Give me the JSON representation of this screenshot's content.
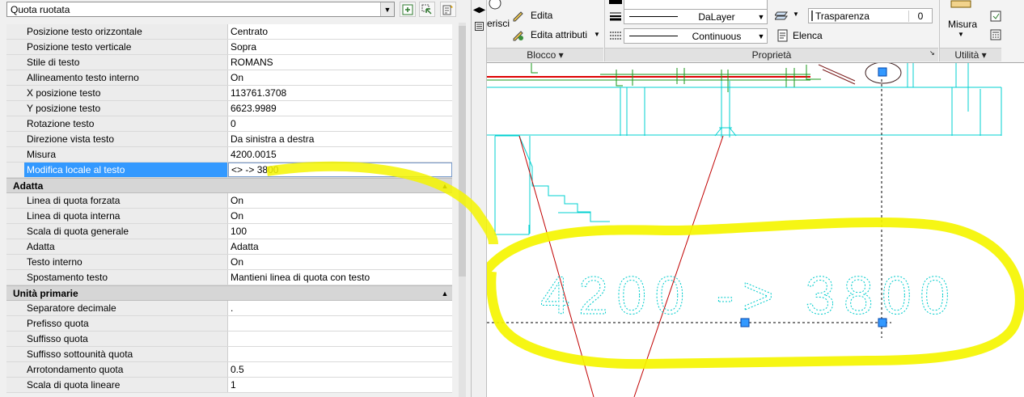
{
  "palette": {
    "selector_value": "Quota ruotata",
    "rows_top": [
      {
        "key": "Posizione testo orizzontale",
        "value": "Centrato"
      },
      {
        "key": "Posizione testo verticale",
        "value": "Sopra"
      },
      {
        "key": "Stile di testo",
        "value": "ROMANS"
      },
      {
        "key": "Allineamento testo interno",
        "value": "On"
      },
      {
        "key": "X posizione testo",
        "value": "113761.3708"
      },
      {
        "key": "Y posizione testo",
        "value": "6623.9989"
      },
      {
        "key": "Rotazione testo",
        "value": "0"
      },
      {
        "key": "Direzione vista testo",
        "value": "Da sinistra a destra"
      },
      {
        "key": "Misura",
        "value": "4200.0015"
      },
      {
        "key": "Modifica locale al testo",
        "value": "<> -> 3800"
      }
    ],
    "cat_adatta": "Adatta",
    "rows_adatta": [
      {
        "key": "Linea di quota forzata",
        "value": "On"
      },
      {
        "key": "Linea di quota interna",
        "value": "On"
      },
      {
        "key": "Scala di quota generale",
        "value": "100"
      },
      {
        "key": "Adatta",
        "value": "Adatta"
      },
      {
        "key": "Testo interno",
        "value": "On"
      },
      {
        "key": "Spostamento testo",
        "value": "Mantieni linea di quota con testo"
      }
    ],
    "cat_unita": "Unità primarie",
    "rows_unita": [
      {
        "key": "Separatore decimale",
        "value": "."
      },
      {
        "key": "Prefisso quota",
        "value": ""
      },
      {
        "key": "Suffisso quota",
        "value": ""
      },
      {
        "key": "Suffisso sottounità quota",
        "value": ""
      },
      {
        "key": "Arrotondamento quota",
        "value": "0.5"
      },
      {
        "key": "Scala di quota lineare",
        "value": "1"
      }
    ]
  },
  "ribbon": {
    "inserisci_fragment": "erisci",
    "edita": "Edita",
    "edita_attributi": "Edita attributi",
    "blocco": "Blocco",
    "dalayer": "DaLayer",
    "continuous": "Continuous",
    "trasparenza": "Trasparenza",
    "trasparenza_value": "0",
    "elenca": "Elenca",
    "proprieta": "Proprietà",
    "misura": "Misura",
    "utilita": "Utilità"
  },
  "drawing": {
    "dimension_text": "4200 -> 3800",
    "accent_highlight": "#f5f500",
    "geometry_color": "#00d0d0",
    "selection_color": "#3399ff"
  },
  "icons": [
    "pick-objects-icon",
    "quick-select-icon",
    "toggle-pickadd-icon",
    "collapse-arrow-icon",
    "edit-icon",
    "edit-attributes-icon",
    "lineweight-icon",
    "linetype-icon",
    "transparency-icon",
    "list-icon",
    "measure-icon",
    "calculator-icon"
  ]
}
